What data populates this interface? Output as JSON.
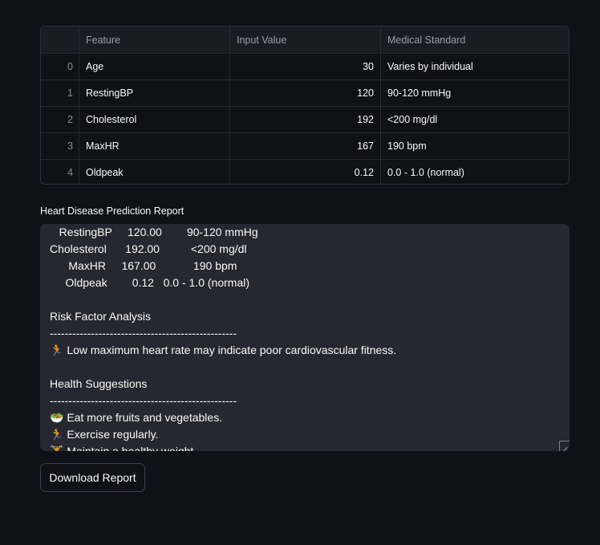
{
  "table": {
    "headers": [
      "",
      "Feature",
      "Input Value",
      "Medical Standard"
    ],
    "rows": [
      {
        "index": "0",
        "feature": "Age",
        "value": "30",
        "standard": "Varies by individual"
      },
      {
        "index": "1",
        "feature": "RestingBP",
        "value": "120",
        "standard": "90-120 mmHg"
      },
      {
        "index": "2",
        "feature": "Cholesterol",
        "value": "192",
        "standard": "<200 mg/dl"
      },
      {
        "index": "3",
        "feature": "MaxHR",
        "value": "167",
        "standard": "190 bpm"
      },
      {
        "index": "4",
        "feature": "Oldpeak",
        "value": "0.12",
        "standard": "0.0 - 1.0 (normal)"
      }
    ]
  },
  "report": {
    "label": "Heart Disease Prediction Report",
    "lines": [
      "   RestingBP     120.00        90-120 mmHg",
      "Cholesterol      192.00          <200 mg/dl",
      "      MaxHR     167.00            190 bpm",
      "     Oldpeak        0.12   0.0 - 1.0 (normal)",
      "",
      "Risk Factor Analysis",
      "--------------------------------------------------",
      "🏃 Low maximum heart rate may indicate poor cardiovascular fitness.",
      "",
      "Health Suggestions",
      "--------------------------------------------------",
      "🥗 Eat more fruits and vegetables.",
      "🏃 Exercise regularly.",
      "🏋 Maintain a healthy weight."
    ]
  },
  "download_button": {
    "label": "Download Report"
  }
}
